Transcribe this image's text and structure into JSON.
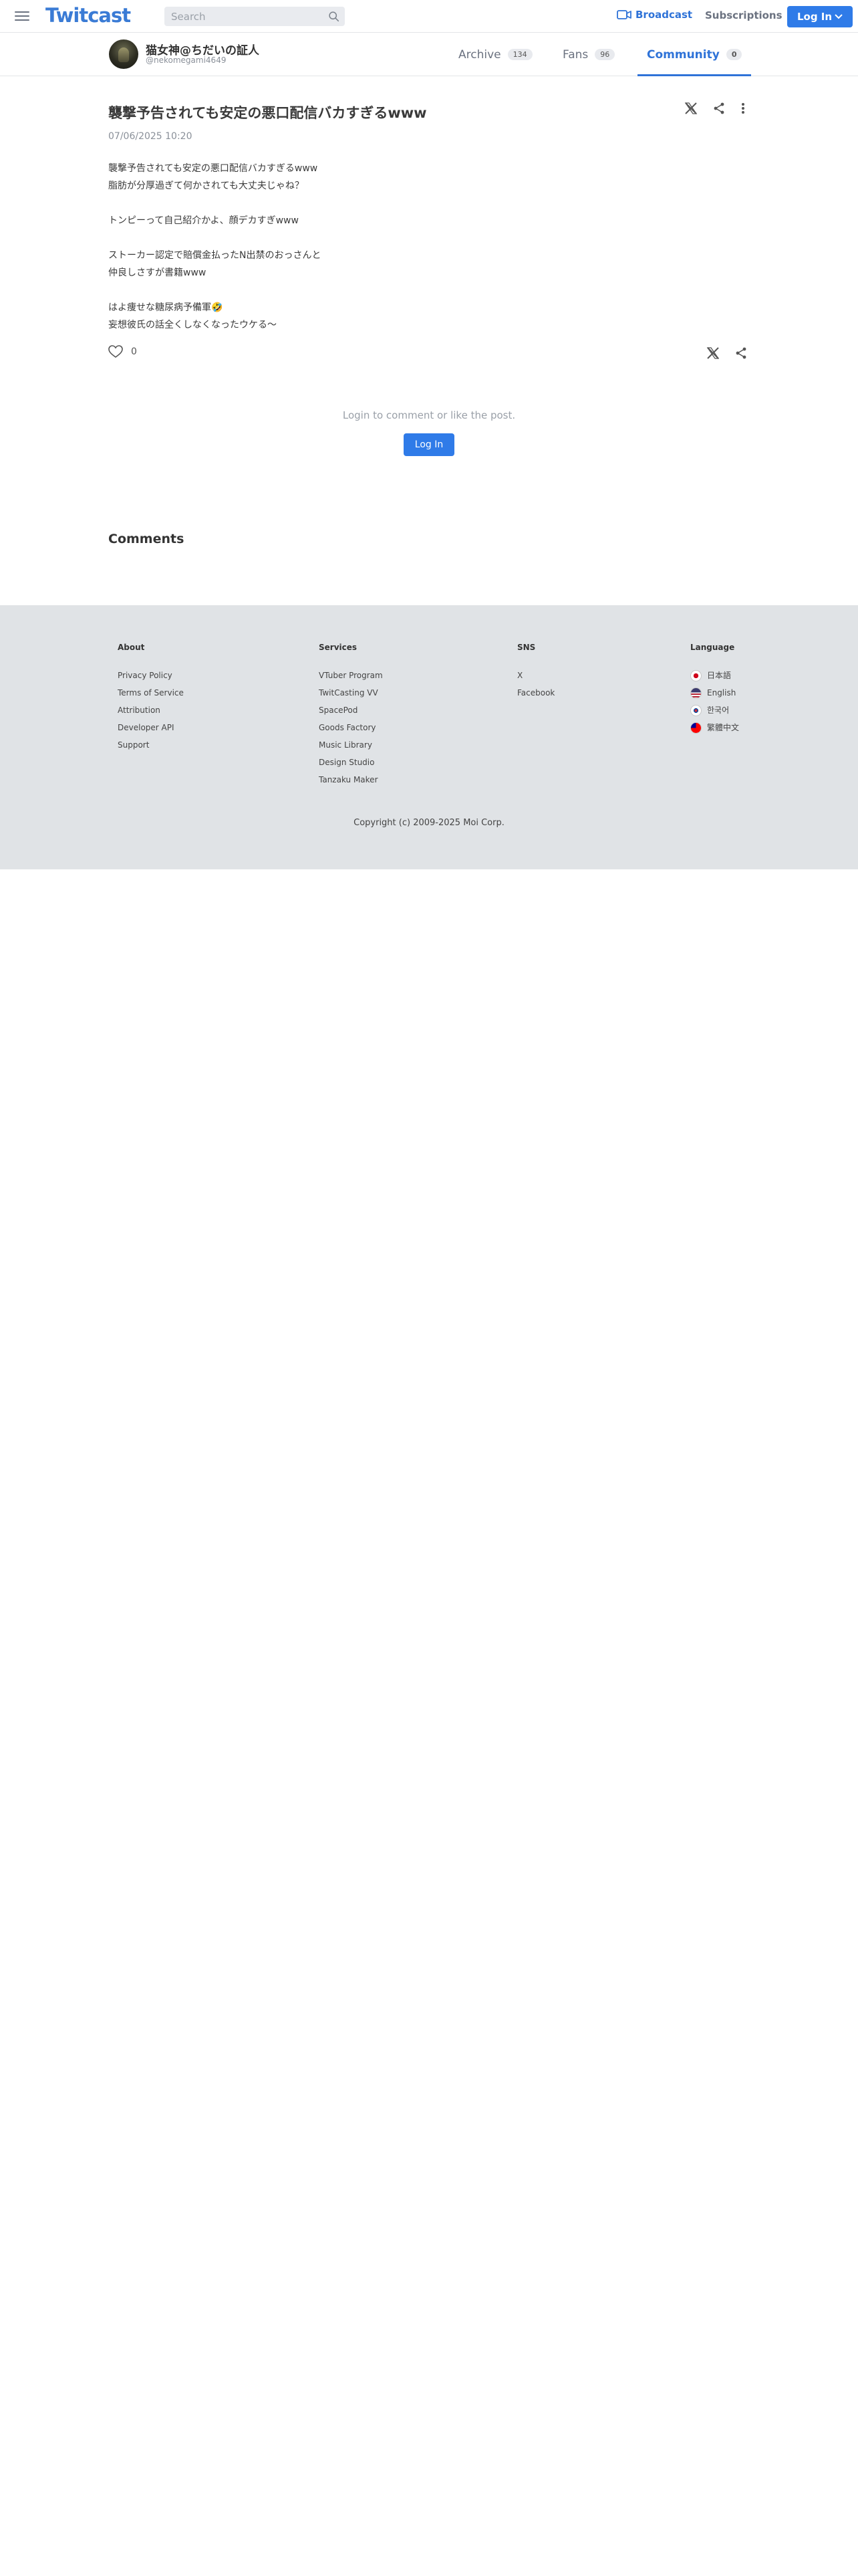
{
  "header": {
    "logo": "Twitcast",
    "search_placeholder": "Search",
    "broadcast_label": "Broadcast",
    "subscriptions_label": "Subscriptions",
    "login_label": "Log In"
  },
  "profile": {
    "name": "猫女神@ちだいの証人",
    "handle": "@nekomegami4649",
    "tabs": [
      {
        "label": "Archive",
        "count": "134"
      },
      {
        "label": "Fans",
        "count": "96"
      },
      {
        "label": "Community",
        "count": "0"
      }
    ]
  },
  "post": {
    "title": "襲撃予告されても安定の悪口配信バカすぎるwww",
    "date": "07/06/2025 10:20",
    "lines": [
      "襲撃予告されても安定の悪口配信バカすぎるwww",
      "脂肪が分厚過ぎて何かされても大丈夫じゃね？",
      "",
      "トンピーって自己紹介かよ、顔デカすぎwww",
      "",
      "ストーカー認定で賠償金払ったN出禁のおっさんと",
      "仲良しさすが書籍www",
      "",
      "はよ痩せな糖尿病予備軍🤣",
      "妄想彼氏の話全くしなくなったウケる〜"
    ],
    "like_count": "0",
    "login_message": "Login to comment or like the post.",
    "login_button": "Log In"
  },
  "comments_heading": "Comments",
  "footer": {
    "about": {
      "title": "About",
      "items": [
        "Privacy Policy",
        "Terms of Service",
        "Attribution",
        "Developer API",
        "Support"
      ]
    },
    "services": {
      "title": "Services",
      "items": [
        "VTuber Program",
        "TwitCasting VV",
        "SpacePod",
        "Goods Factory",
        "Music Library",
        "Design Studio",
        "Tanzaku Maker"
      ]
    },
    "sns": {
      "title": "SNS",
      "items": [
        "X",
        "Facebook"
      ]
    },
    "language": {
      "title": "Language",
      "items": [
        "日本語",
        "English",
        "한국어",
        "繁體中文"
      ]
    },
    "copyright": "Copyright (c) 2009-2025 Moi Corp."
  },
  "colors": {
    "accent": "#2f7be8",
    "footer_bg": "#e0e3e6"
  }
}
